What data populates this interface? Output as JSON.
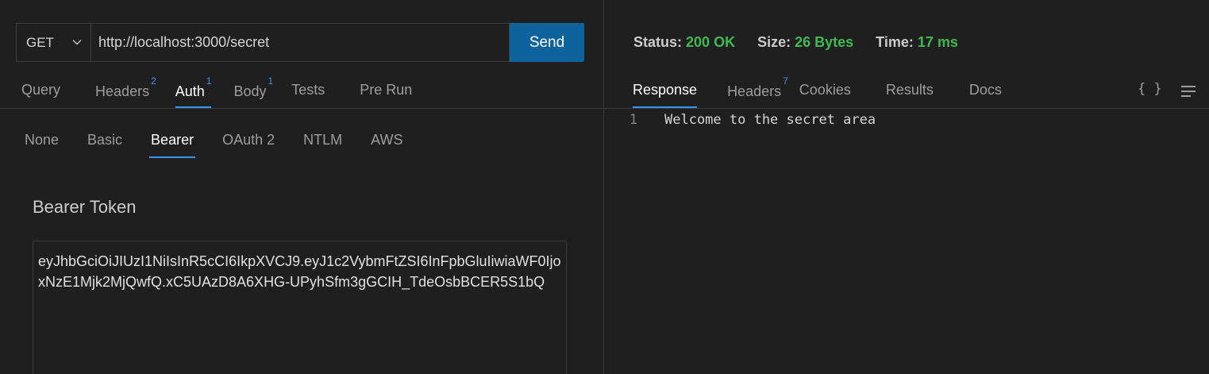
{
  "request": {
    "method": "GET",
    "url": "http://localhost:3000/secret",
    "send_label": "Send",
    "tabs": [
      {
        "label": "Query",
        "badge": ""
      },
      {
        "label": "Headers",
        "badge": "2"
      },
      {
        "label": "Auth",
        "badge": "1"
      },
      {
        "label": "Body",
        "badge": "1"
      },
      {
        "label": "Tests",
        "badge": ""
      },
      {
        "label": "Pre Run",
        "badge": ""
      }
    ],
    "active_tab": "Auth"
  },
  "auth": {
    "subtabs": [
      "None",
      "Basic",
      "Bearer",
      "OAuth 2",
      "NTLM",
      "AWS"
    ],
    "active_subtab": "Bearer",
    "token_label": "Bearer Token",
    "token_value": "eyJhbGciOiJIUzI1NiIsInR5cCI6IkpXVCJ9.eyJ1c2VybmFtZSI6InFpbGluIiwiaWF0IjoxNzE1Mjk2MjQwfQ.xC5UAzD8A6XHG-UPyhSfm3gGCIH_TdeOsbBCER5S1bQ"
  },
  "response": {
    "status_label": "Status:",
    "status_value": "200 OK",
    "size_label": "Size:",
    "size_value": "26 Bytes",
    "time_label": "Time:",
    "time_value": "17 ms",
    "tabs": [
      {
        "label": "Response",
        "badge": ""
      },
      {
        "label": "Headers",
        "badge": "7"
      },
      {
        "label": "Cookies",
        "badge": ""
      },
      {
        "label": "Results",
        "badge": ""
      },
      {
        "label": "Docs",
        "badge": ""
      }
    ],
    "active_tab": "Response",
    "format_icon_glyph": "{ }",
    "lines": [
      {
        "num": "1",
        "text": "Welcome to the secret area"
      }
    ]
  },
  "colors": {
    "accent": "#3794ff",
    "send_button": "#0e639c",
    "status_ok": "#3fb950",
    "background": "#1f1f1f"
  },
  "icons": [
    "chevron-down-icon",
    "format-json-icon",
    "menu-lines-icon"
  ]
}
